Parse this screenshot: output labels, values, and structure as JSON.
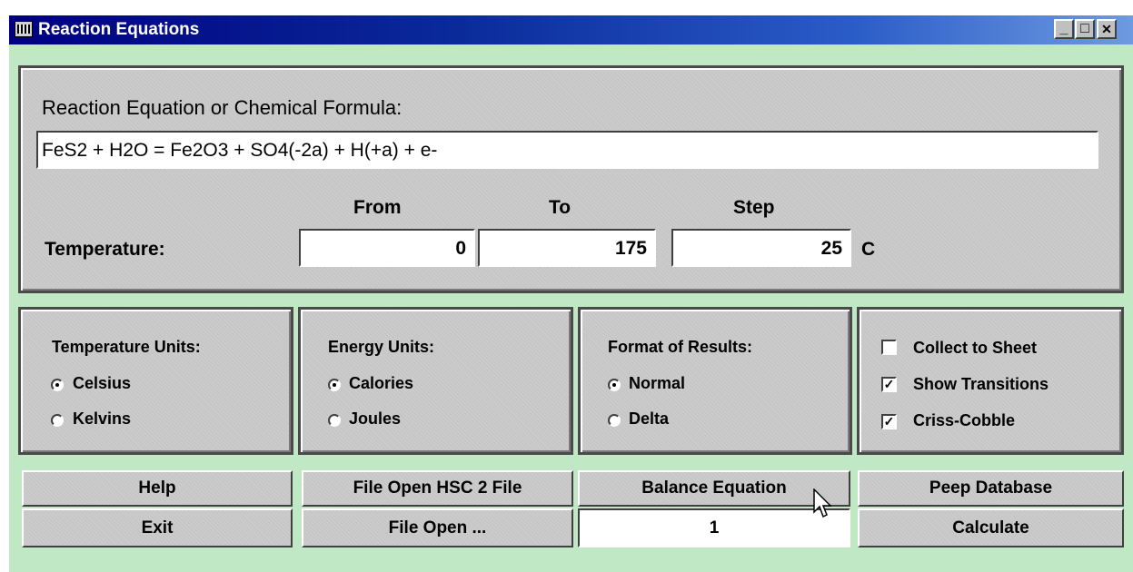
{
  "window": {
    "title": "Reaction Equations",
    "min_glyph": "_",
    "max_glyph": "□",
    "close_glyph": "✕"
  },
  "equation": {
    "label": "Reaction Equation or Chemical Formula:",
    "value": "FeS2 + H2O = Fe2O3 + SO4(-2a) + H(+a) + e-"
  },
  "temperature": {
    "label": "Temperature:",
    "from_label": "From",
    "to_label": "To",
    "step_label": "Step",
    "from": "0",
    "to": "175",
    "step": "25",
    "unit": "C"
  },
  "temperature_units": {
    "title": "Temperature Units:",
    "options": [
      "Celsius",
      "Kelvins"
    ],
    "selected": "Celsius"
  },
  "energy_units": {
    "title": "Energy Units:",
    "options": [
      "Calories",
      "Joules"
    ],
    "selected": "Calories"
  },
  "format_results": {
    "title": "Format of Results:",
    "options": [
      "Normal",
      "Delta"
    ],
    "selected": "Normal"
  },
  "options": {
    "collect_to_sheet": "Collect to Sheet",
    "collect_checked": false,
    "show_transitions": "Show Transitions",
    "transitions_checked": true,
    "criss_cobble": "Criss-Cobble",
    "criss_checked": true,
    "check_glyph": "✓"
  },
  "buttons": {
    "help": "Help",
    "exit": "Exit",
    "file_open_hsc2": "File Open HSC 2 File",
    "file_open": "File Open ...",
    "balance": "Balance Equation",
    "peep": "Peep Database",
    "calculate": "Calculate"
  },
  "balance_count": "1"
}
